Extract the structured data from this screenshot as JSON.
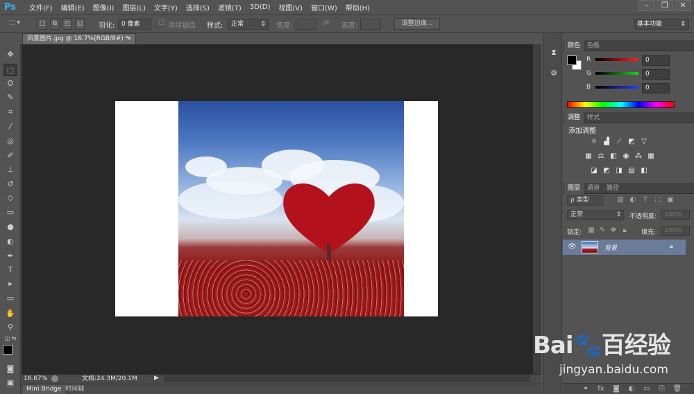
{
  "app": {
    "logo": "Ps"
  },
  "menu": [
    "文件(F)",
    "编辑(E)",
    "图像(I)",
    "图层(L)",
    "文字(Y)",
    "选择(S)",
    "滤镜(T)",
    "3D(D)",
    "视图(V)",
    "窗口(W)",
    "帮助(H)"
  ],
  "window_controls": {
    "minimize": "–",
    "restore": "❐",
    "close": "✕"
  },
  "options": {
    "feather_label": "羽化:",
    "feather_value": "0 像素",
    "antialias_label": "消除锯齿",
    "style_label": "样式:",
    "style_value": "正常",
    "width_label": "宽度:",
    "height_label": "高度:",
    "refine_edge_button": "调整边缘...",
    "workspace": "基本功能"
  },
  "document_tab": {
    "title": "风景图片.jpg @ 16.7%(RGB/8#) *",
    "close": "×"
  },
  "status": {
    "zoom": "16.67%",
    "doc_info": "文档:24.3M/20.1M"
  },
  "bottom_tabs": [
    "Mini Bridge",
    "时间轴"
  ],
  "color_panel": {
    "tabs": [
      "颜色",
      "色板"
    ],
    "channels": [
      {
        "label": "R",
        "value": "0",
        "color": "#ff2020"
      },
      {
        "label": "G",
        "value": "0",
        "color": "#20d020"
      },
      {
        "label": "B",
        "value": "0",
        "color": "#2040ff"
      }
    ]
  },
  "adjustments_panel": {
    "tabs": [
      "调整",
      "样式"
    ],
    "heading": "添加调整"
  },
  "layers_panel": {
    "tabs": [
      "图层",
      "通道",
      "路径"
    ],
    "filter": "ρ 类型",
    "blend_mode": "正常",
    "opacity_label": "不透明度:",
    "opacity_value": "100%",
    "lock_label": "锁定:",
    "fill_label": "填充:",
    "fill_value": "100%",
    "layers": [
      {
        "name": "背景",
        "visible": true,
        "locked": true
      }
    ]
  },
  "watermark": {
    "logo": "Bai🐾百经验",
    "url": "jingyan.baidu.com"
  },
  "colors": {
    "accent": "#3fa9f5",
    "ui_bg": "#535353",
    "canvas_bg": "#282828",
    "selected_layer": "#6b7b9a"
  }
}
